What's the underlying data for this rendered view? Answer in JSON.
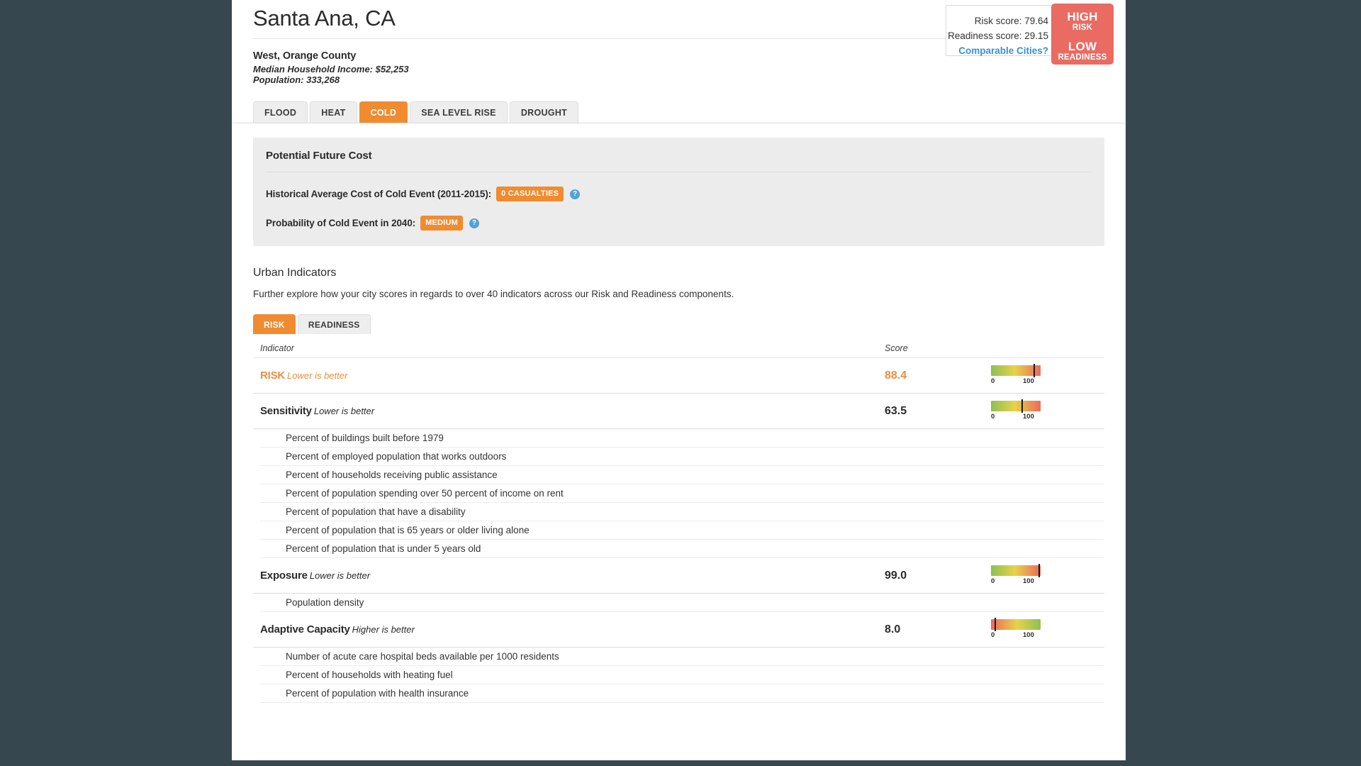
{
  "header": {
    "city": "Santa Ana, CA",
    "region": "West, Orange County",
    "median_income": "Median Household Income: $52,253",
    "population": "Population: 333,268"
  },
  "score_panel": {
    "risk_score": "Risk score: 79.64",
    "readiness_score": "Readiness score: 29.15",
    "comparable_link": "Comparable Cities?",
    "badge": {
      "risk_level": "HIGH",
      "risk_label": "RISK",
      "readiness_level": "LOW",
      "readiness_label": "READINESS",
      "color": "#e96b62"
    }
  },
  "hazard_tabs": [
    {
      "label": "FLOOD",
      "active": false
    },
    {
      "label": "HEAT",
      "active": false
    },
    {
      "label": "COLD",
      "active": true
    },
    {
      "label": "SEA LEVEL RISE",
      "active": false
    },
    {
      "label": "DROUGHT",
      "active": false
    }
  ],
  "future_cost": {
    "title": "Potential Future Cost",
    "rows": [
      {
        "label": "Historical Average Cost of Cold Event (2011-2015):",
        "pill": "0 CASUALTIES"
      },
      {
        "label": "Probability of Cold Event in 2040:",
        "pill": "MEDIUM"
      }
    ],
    "help_glyph": "?"
  },
  "urban_indicators": {
    "title": "Urban Indicators",
    "description": "Further explore how your city scores in regards to over 40 indicators across our Risk and Readiness components.",
    "tabs": [
      {
        "label": "RISK",
        "active": true
      },
      {
        "label": "READINESS",
        "active": false
      }
    ],
    "columns": {
      "indicator": "Indicator",
      "score": "Score"
    },
    "gauge_ticks": {
      "min": "0",
      "max": "100"
    },
    "rows": [
      {
        "type": "group",
        "name": "RISK",
        "hint": "Lower is better",
        "score": "88.4",
        "gauge_value": 88.4,
        "reverse": false,
        "accent": true
      },
      {
        "type": "group",
        "name": "Sensitivity",
        "hint": "Lower is better",
        "score": "63.5",
        "gauge_value": 63.5,
        "reverse": false,
        "accent": false
      },
      {
        "type": "sub",
        "name": "Percent of buildings built before 1979"
      },
      {
        "type": "sub",
        "name": "Percent of employed population that works outdoors"
      },
      {
        "type": "sub",
        "name": "Percent of households receiving public assistance"
      },
      {
        "type": "sub",
        "name": "Percent of population spending over 50 percent of income on rent"
      },
      {
        "type": "sub",
        "name": "Percent of population that have a disability"
      },
      {
        "type": "sub",
        "name": "Percent of population that is 65 years or older living alone"
      },
      {
        "type": "sub",
        "name": "Percent of population that is under 5 years old"
      },
      {
        "type": "group",
        "name": "Exposure",
        "hint": "Lower is better",
        "score": "99.0",
        "gauge_value": 99.0,
        "reverse": false,
        "accent": false
      },
      {
        "type": "sub",
        "name": "Population density"
      },
      {
        "type": "group",
        "name": "Adaptive Capacity",
        "hint": "Higher is better",
        "score": "8.0",
        "gauge_value": 8.0,
        "reverse": true,
        "accent": false
      },
      {
        "type": "sub",
        "name": "Number of acute care hospital beds available per 1000 residents"
      },
      {
        "type": "sub",
        "name": "Percent of households with heating fuel"
      },
      {
        "type": "sub",
        "name": "Percent of population with health insurance"
      }
    ]
  },
  "colors": {
    "accent_orange": "#f08b30",
    "risk_red": "#e96b62",
    "link_blue": "#3c90d4",
    "page_bg": "#36474f"
  }
}
